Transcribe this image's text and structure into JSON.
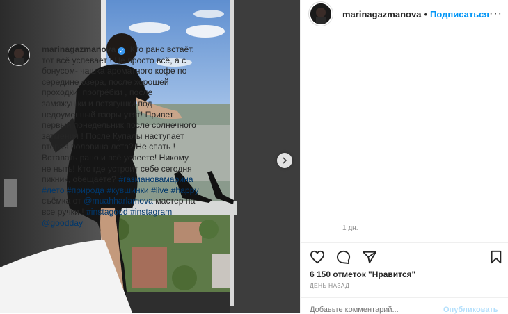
{
  "post": {
    "username": "marinagazmanova",
    "follow_label": "Подписаться",
    "dot": "•",
    "more_label": "···"
  },
  "caption": {
    "username": "marinagazmanova",
    "verified_mark": "✓",
    "text_part1": "Кто рано встаёт, тот всё успевает ! Не просто всё, а с бонусом- чашка ароматного кофе по середине озера, после хорошей проходки, прогрёбки , после замяжушки и потягушки под недоуменный взоры утят! Привет первый понедельник после солнечного затмения ! После Купалы наступает вторая половина лета? Не спать ! Вставать рано и всё успеете! Никому не ныть! Кто где устроит себе сегодня пикник, обещаете?",
    "tags_line1": [
      "#газмановамарина",
      "#лето"
    ],
    "tags_line2": [
      "#природа",
      "#кувшинки",
      "#live",
      "#happy"
    ],
    "photo_credit_prefix": "съёмка от",
    "photo_credit_user": "@muahharlamova",
    "credit_suffix": "мастер на все ручки !",
    "tags_line3": [
      "#instagood",
      "#instagram"
    ],
    "tags_line4": [
      "@goodday"
    ],
    "age": "1 дн."
  },
  "stats": {
    "likes": "6 150 отметок \"Нравится\"",
    "time_ago": "ДЕНЬ НАЗАД"
  },
  "comment": {
    "placeholder": "Добавьте комментарий...",
    "publish_label": "Опубликовать"
  },
  "colors": {
    "link": "#00376b",
    "follow": "#0095f6",
    "muted": "#8e8e8e",
    "verified": "#3897f0"
  }
}
